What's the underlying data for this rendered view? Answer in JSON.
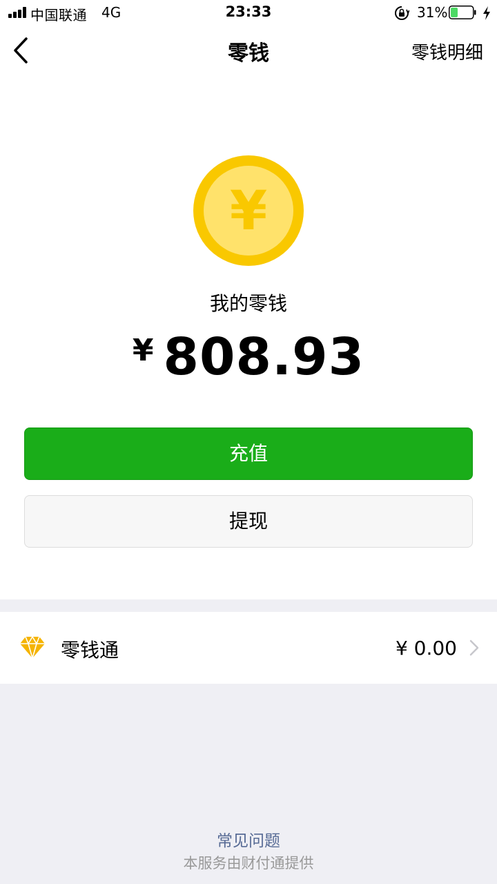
{
  "status_bar": {
    "carrier": "中国联通",
    "network": "4G",
    "time": "23:33",
    "battery_percent": "31%",
    "battery_level": 0.31,
    "icons": [
      "signal-icon",
      "orientation-lock-icon",
      "battery-icon",
      "charging-icon"
    ]
  },
  "nav": {
    "title": "零钱",
    "right_label": "零钱明细",
    "back_icon": "chevron-left-icon"
  },
  "balance": {
    "coin_icon": "yuan-coin-icon",
    "coin_glyph": "¥",
    "label": "我的零钱",
    "currency_symbol": "¥",
    "amount": "808.93"
  },
  "actions": {
    "recharge_label": "充值",
    "withdraw_label": "提现"
  },
  "lingqiantong": {
    "icon": "diamond-icon",
    "label": "零钱通",
    "value": "¥ 0.00"
  },
  "footer": {
    "faq_label": "常见问题",
    "provider_text": "本服务由财付通提供"
  },
  "colors": {
    "primary_green": "#1AAD19",
    "link_blue": "#576B95",
    "coin_outer": "#F9C800",
    "coin_inner": "#FFE26B",
    "diamond": "#F5B400",
    "battery_fill": "#4CD964"
  }
}
